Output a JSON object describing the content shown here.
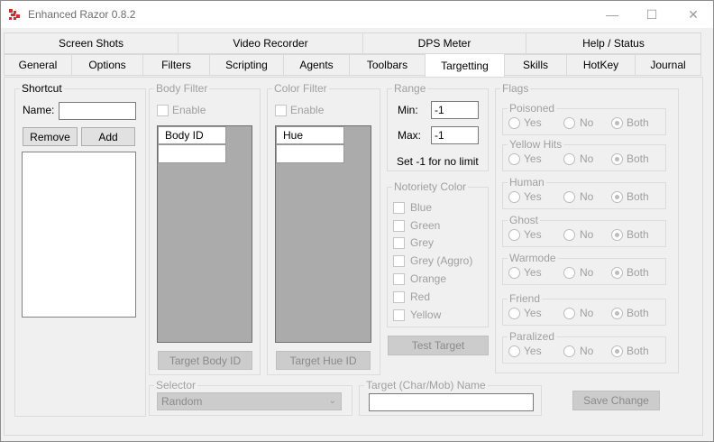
{
  "window": {
    "title": "Enhanced Razor 0.8.2",
    "minimize_glyph": "—",
    "maximize_glyph": "☐",
    "close_glyph": "✕"
  },
  "tabs": {
    "row1": [
      "Screen Shots",
      "Video Recorder",
      "DPS Meter",
      "Help / Status"
    ],
    "row2": [
      "General",
      "Options",
      "Filters",
      "Scripting",
      "Agents",
      "Toolbars",
      "Targetting",
      "Skills",
      "HotKey",
      "Journal"
    ],
    "active": "Targetting"
  },
  "shortcut": {
    "title": "Shortcut",
    "name_label": "Name:",
    "name_value": "",
    "remove_label": "Remove",
    "add_label": "Add"
  },
  "body_filter": {
    "title": "Body Filter",
    "enable_label": "Enable",
    "column_header": "Body ID",
    "button_label": "Target Body ID"
  },
  "color_filter": {
    "title": "Color Filter",
    "enable_label": "Enable",
    "column_header": "Hue",
    "button_label": "Target Hue ID"
  },
  "range": {
    "title": "Range",
    "min_label": "Min:",
    "min_value": "-1",
    "max_label": "Max:",
    "max_value": "-1",
    "hint": "Set -1 for no limit"
  },
  "notoriety": {
    "title": "Notoriety Color",
    "items": [
      "Blue",
      "Green",
      "Grey",
      "Grey (Aggro)",
      "Orange",
      "Red",
      "Yellow"
    ]
  },
  "test_button_label": "Test Target",
  "flags": {
    "title": "Flags",
    "groups": [
      {
        "name": "Poisoned",
        "selected": "Both"
      },
      {
        "name": "Yellow Hits",
        "selected": "Both"
      },
      {
        "name": "Human",
        "selected": "Both"
      },
      {
        "name": "Ghost",
        "selected": "Both"
      },
      {
        "name": "Warmode",
        "selected": "Both"
      },
      {
        "name": "Friend",
        "selected": "Both"
      },
      {
        "name": "Paralized",
        "selected": "Both"
      }
    ],
    "options": [
      "Yes",
      "No",
      "Both"
    ]
  },
  "selector": {
    "title": "Selector",
    "value": "Random"
  },
  "target_name": {
    "title": "Target (Char/Mob) Name",
    "value": ""
  },
  "save_label": "Save Change",
  "colors": {
    "background": "#f0f0f0",
    "grid_gray": "#ababab",
    "disabled_text": "#a0a0a0",
    "app_icon": "#d42a2a"
  }
}
